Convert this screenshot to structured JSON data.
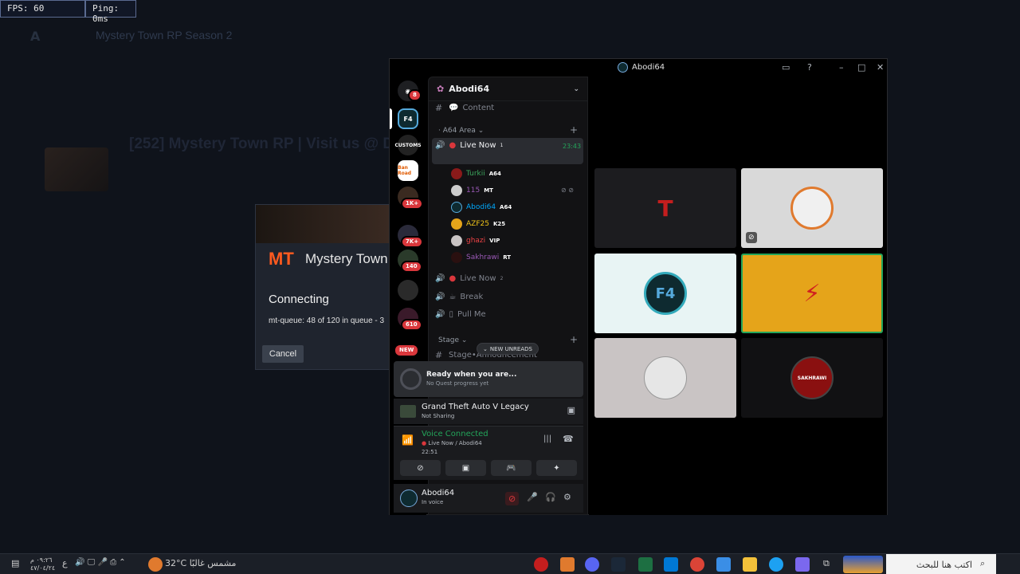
{
  "overlay": {
    "fps": "FPS: 60",
    "ping": "Ping: 0ms"
  },
  "launcher": {
    "title": "Mystery Town RP Season 2",
    "server_title": "[252] Mystery Town RP | Visit us @ D"
  },
  "dialog": {
    "brand": "Mystery Town",
    "status": "Connecting",
    "queue": "mt-queue: 48 of 120 in queue - 3",
    "cancel": "Cancel"
  },
  "discord": {
    "window_title": "Abodi64",
    "server_name": "Abodi64",
    "channels": {
      "content": "Content",
      "category_a64": "A64 Area",
      "live_now_1": "Live Now",
      "live_now_1_sup": "1",
      "live_time": "23:43",
      "live_now_2": "Live Now",
      "live_now_2_sup": "2",
      "break": "Break",
      "pull_me": "Pull Me",
      "category_stage": "Stage",
      "stage_announcement": "Stage•Announcement"
    },
    "voice_users": [
      {
        "name": "Turkii",
        "tag": "A64",
        "color": "#3ba55c"
      },
      {
        "name": "115",
        "tag": "MT",
        "color": "#9b59b6"
      },
      {
        "name": "Abodi64",
        "tag": "A64",
        "color": "#00a8fc"
      },
      {
        "name": "AZF25",
        "tag": "K25",
        "color": "#f0c419"
      },
      {
        "name": "ghazi",
        "tag": "VIP",
        "color": "#ed4245"
      },
      {
        "name": "Sakhrawi",
        "tag": "RT",
        "color": "#9b59b6"
      }
    ],
    "new_unreads": "NEW UNREADS",
    "quest": {
      "title": "Ready when you are...",
      "subtitle": "No Quest progress yet"
    },
    "game": {
      "title": "Grand Theft Auto V Legacy",
      "subtitle": "Not Sharing"
    },
    "rtc": {
      "status": "Voice Connected",
      "channel": "Live Now / Abodi64",
      "time": "22:51"
    },
    "user": {
      "name": "Abodi64",
      "status": "In voice"
    },
    "rail_badges": {
      "home": "8",
      "b1": "1K+",
      "b2": "7K+",
      "b3": "140",
      "b4": "610",
      "new": "NEW"
    },
    "rail_labels": {
      "customs": "CUSTOMS",
      "ban": "Ban Road"
    },
    "tiles": [
      {
        "label": "T",
        "bg": "#1c1c1f",
        "fg": "#c41e1e"
      },
      {
        "label": "",
        "bg": "#d9d9d9",
        "fg": "#e07a2e"
      },
      {
        "label": "F4",
        "bg": "#e8f4f4",
        "fg": "#1a6a7a"
      },
      {
        "label": "⚡",
        "bg": "#e5a41a",
        "fg": "#d02020"
      },
      {
        "label": "",
        "bg": "#c9c4c4",
        "fg": "#555"
      },
      {
        "label": "SAKHRAWI",
        "bg": "#111113",
        "fg": "#e0e0e0"
      }
    ]
  },
  "taskbar": {
    "weather": "32°C  مشمس غالبًا",
    "search": "اكتب هنا للبحث",
    "time": "٠٩:٢٦ م",
    "date": "٤٧/٠٤/٢٤",
    "lang": "ع"
  }
}
